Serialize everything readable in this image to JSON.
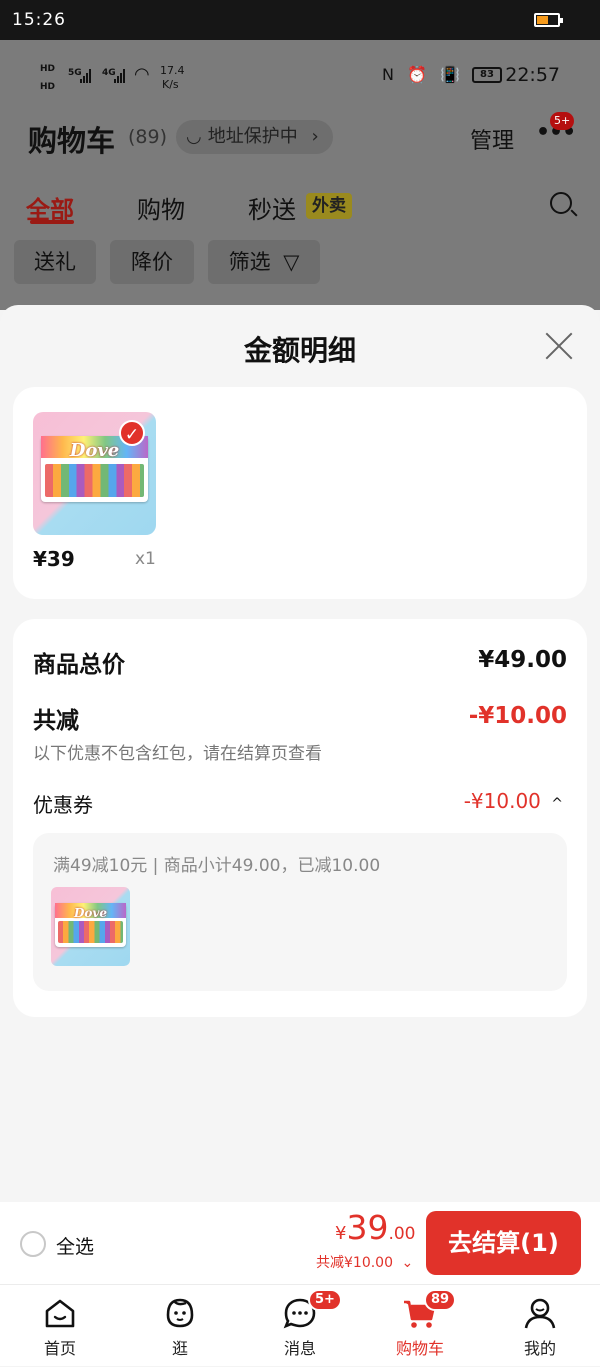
{
  "outer_status": {
    "time": "15:26"
  },
  "background_app": {
    "status": {
      "hd1": "HD",
      "hd2": "HD",
      "net1": "5G",
      "net2": "4G",
      "speed": "17.4",
      "speed_unit": "K/s",
      "icons": "N ⏰ 📳",
      "battery": "83",
      "time": "22:57"
    },
    "title": "购物车",
    "count": "(89)",
    "address_label": "地址保护中",
    "address_chevron": "›",
    "manage_label": "管理",
    "more_badge": "5+",
    "tabs": [
      "全部",
      "购物",
      "秒送"
    ],
    "tab_badge": "外卖",
    "chips": [
      "送礼",
      "降价",
      "筛选"
    ]
  },
  "sheet": {
    "title": "金额明细",
    "item": {
      "price": "¥39",
      "qty": "x1",
      "brand": "Dove",
      "check": "✓"
    },
    "total_label": "商品总价",
    "total_value": "¥49.00",
    "discount_label": "共减",
    "discount_value": "-¥10.00",
    "discount_note": "以下优惠不包含红包，请在结算页查看",
    "coupon_label": "优惠券",
    "coupon_value": "-¥10.00",
    "coupon_chevron": "^",
    "coupon_detail": "满49减10元 | 商品小计49.00，已减10.00"
  },
  "checkout": {
    "select_all": "全选",
    "currency": "¥",
    "price_int": "39",
    "price_dec": ".00",
    "saved_text": "共减¥10.00",
    "saved_chevron": "⌄",
    "button": "去结算(1)"
  },
  "tab_bar": {
    "items": [
      {
        "label": "首页",
        "icon": "home-icon"
      },
      {
        "label": "逛",
        "icon": "browse-face-icon"
      },
      {
        "label": "消息",
        "icon": "message-icon",
        "badge": "5+"
      },
      {
        "label": "购物车",
        "icon": "cart-icon",
        "badge": "89"
      },
      {
        "label": "我的",
        "icon": "profile-icon"
      }
    ]
  },
  "colors": {
    "accent": "#e1322a",
    "sheet_bg": "#f5f5f5",
    "dim_bg": "#7b7b7b"
  }
}
